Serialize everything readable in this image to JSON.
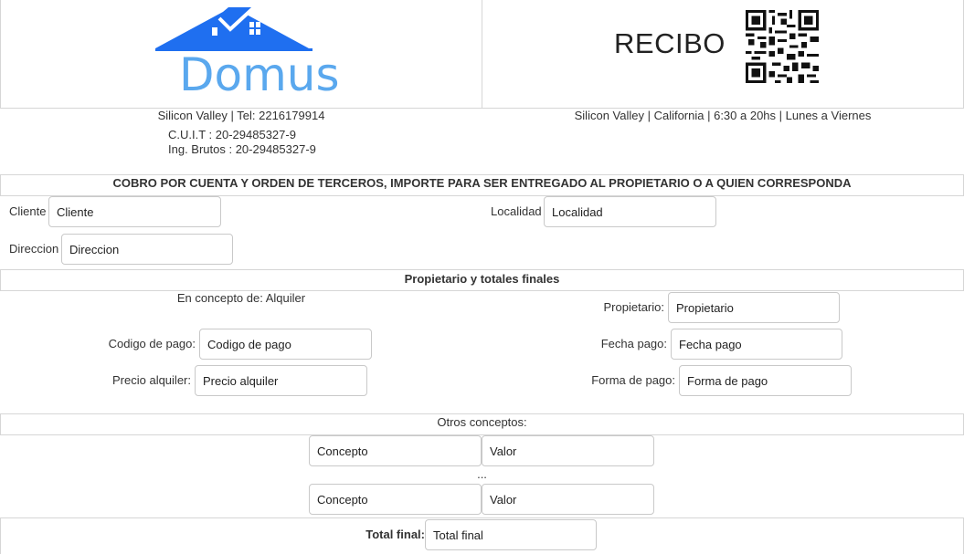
{
  "header": {
    "brand": "Domus",
    "doc_title": "RECIBO",
    "left_info": "Silicon Valley | Tel: 2216179914",
    "cuit": "C.U.I.T : 20-29485327-9",
    "ing_brutos": "Ing. Brutos : 20-29485327-9",
    "right_info": "Silicon Valley | California | 6:30 a 20hs | Lunes a Viernes",
    "logo_icon": "house-roof-icon",
    "qr_icon": "qr-code-icon",
    "brand_color": "#5aa8ee",
    "roof_color": "#1f6ff0"
  },
  "banner": "COBRO POR CUENTA Y ORDEN DE TERCEROS, IMPORTE PARA SER ENTREGADO AL PROPIETARIO O A QUIEN CORRESPONDA",
  "client": {
    "cliente_label": "Cliente",
    "cliente_placeholder": "Cliente",
    "localidad_label": "Localidad",
    "localidad_placeholder": "Localidad",
    "direccion_label": "Direccion",
    "direccion_placeholder": "Direccion"
  },
  "section_owner": "Propietario y totales finales",
  "owner": {
    "concept_text": "En concepto de: Alquiler",
    "propietario_label": "Propietario:",
    "propietario_placeholder": "Propietario",
    "codigo_label": "Codigo de pago:",
    "codigo_placeholder": "Codigo de pago",
    "fecha_label": "Fecha pago:",
    "fecha_placeholder": "Fecha pago",
    "precio_label": "Precio alquiler:",
    "precio_placeholder": "Precio alquiler",
    "forma_label": "Forma de pago:",
    "forma_placeholder": "Forma de pago"
  },
  "others": {
    "title": "Otros conceptos:",
    "ellipsis": "...",
    "rows": [
      {
        "concepto_placeholder": "Concepto",
        "valor_placeholder": "Valor"
      },
      {
        "concepto_placeholder": "Concepto",
        "valor_placeholder": "Valor"
      }
    ]
  },
  "total": {
    "label": "Total final:",
    "placeholder": "Total final"
  }
}
